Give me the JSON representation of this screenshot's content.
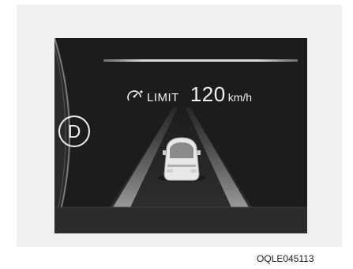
{
  "cluster": {
    "gear": "D",
    "limit_label": "LIMIT",
    "speed_value": "120",
    "speed_unit": "km/h",
    "limit_icon": "speed-limit-icon",
    "vehicle_icon": "vehicle-icon"
  },
  "caption": "OQLE045113",
  "colors": {
    "panel": "#f0f0f0",
    "screen": "#1c1c1c",
    "text": "#f2f2f2"
  }
}
